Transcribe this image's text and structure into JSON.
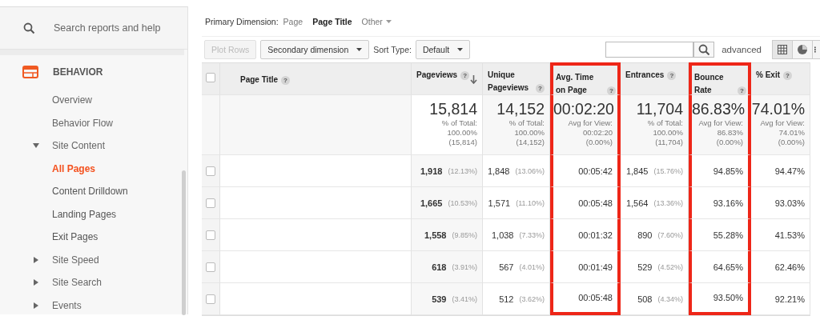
{
  "sidebar": {
    "search": {
      "placeholder": "Search reports and help"
    },
    "section": {
      "label": "BEHAVIOR",
      "children": [
        {
          "label": "Overview",
          "selected": false
        },
        {
          "label": "Behavior Flow",
          "selected": false
        },
        {
          "label": "Site Content",
          "selected": false,
          "expanded": true,
          "children": [
            {
              "label": "All Pages",
              "selected": true
            },
            {
              "label": "Content Drilldown",
              "selected": false
            },
            {
              "label": "Landing Pages",
              "selected": false
            },
            {
              "label": "Exit Pages",
              "selected": false
            }
          ]
        },
        {
          "label": "Site Speed",
          "selected": false,
          "expanded": false
        },
        {
          "label": "Site Search",
          "selected": false,
          "expanded": false
        },
        {
          "label": "Events",
          "selected": false,
          "expanded": false
        }
      ]
    }
  },
  "primary_dimension": {
    "label": "Primary Dimension:",
    "options": [
      {
        "label": "Page",
        "selected": false,
        "dropdown": false
      },
      {
        "label": "Page Title",
        "selected": true,
        "dropdown": false
      },
      {
        "label": "Other",
        "selected": false,
        "dropdown": true
      }
    ]
  },
  "toolbar": {
    "plot_rows": {
      "label": "Plot Rows",
      "disabled": true
    },
    "secondary_dimension": {
      "label": "Secondary dimension"
    },
    "sort_type_label": "Sort Type:",
    "sort_type": {
      "value": "Default"
    },
    "filter": {
      "focused": false
    },
    "advanced": "advanced",
    "views": [
      {
        "kind": "grid",
        "selected": true
      },
      {
        "kind": "pie",
        "selected": false
      },
      {
        "kind": "list",
        "selected": false
      }
    ]
  },
  "table": {
    "select_all": {
      "checked": false
    },
    "columns": [
      {
        "label": "Page Title",
        "help": "?",
        "sorted": false,
        "highlighted": false
      },
      {
        "label": "Pageviews",
        "help": "?",
        "sorted": true,
        "highlighted": false
      },
      {
        "label": "Unique Pageviews",
        "help": "?",
        "sorted": false,
        "highlighted": false
      },
      {
        "label": "Avg. Time on Page",
        "help": "?",
        "sorted": false,
        "highlighted": true
      },
      {
        "label": "Entrances",
        "help": "?",
        "sorted": false,
        "highlighted": false
      },
      {
        "label": "Bounce Rate",
        "help": "?",
        "sorted": false,
        "highlighted": true
      },
      {
        "label": "% Exit",
        "help": "?",
        "sorted": false,
        "highlighted": false
      }
    ],
    "totals": [
      {
        "value": "15,814",
        "lines": [
          "% of Total:",
          "100.00%",
          "(15,814)"
        ]
      },
      {
        "value": "14,152",
        "lines": [
          "% of Total:",
          "100.00%",
          "(14,152)"
        ]
      },
      {
        "value": "00:02:20",
        "lines": [
          "Avg for View:",
          "00:02:20",
          "(0.00%)"
        ]
      },
      {
        "value": "11,704",
        "lines": [
          "% of Total:",
          "100.00%",
          "(11,704)"
        ]
      },
      {
        "value": "86.83%",
        "lines": [
          "Avg for View:",
          "86.83%",
          "(0.00%)"
        ]
      },
      {
        "value": "74.01%",
        "lines": [
          "Avg for View:",
          "74.01%",
          "(0.00%)"
        ]
      }
    ],
    "rows": [
      {
        "checked": false,
        "cells": [
          {},
          {
            "value": "1,918",
            "share": "(12.13%)"
          },
          {
            "value": "1,848",
            "share": "(13.06%)"
          },
          {
            "value": "00:05:42"
          },
          {
            "value": "1,845",
            "share": "(15.76%)"
          },
          {
            "value": "94.85%"
          },
          {
            "value": "94.47%"
          }
        ]
      },
      {
        "checked": false,
        "cells": [
          {},
          {
            "value": "1,665",
            "share": "(10.53%)"
          },
          {
            "value": "1,571",
            "share": "(11.10%)"
          },
          {
            "value": "00:05:48"
          },
          {
            "value": "1,564",
            "share": "(13.36%)"
          },
          {
            "value": "93.16%"
          },
          {
            "value": "93.03%"
          }
        ]
      },
      {
        "checked": false,
        "cells": [
          {},
          {
            "value": "1,558",
            "share": "(9.85%)"
          },
          {
            "value": "1,038",
            "share": "(7.33%)"
          },
          {
            "value": "00:01:32"
          },
          {
            "value": "890",
            "share": "(7.60%)"
          },
          {
            "value": "55.28%"
          },
          {
            "value": "41.53%"
          }
        ]
      },
      {
        "checked": false,
        "cells": [
          {},
          {
            "value": "618",
            "share": "(3.91%)"
          },
          {
            "value": "567",
            "share": "(4.01%)"
          },
          {
            "value": "00:01:49"
          },
          {
            "value": "529",
            "share": "(4.52%)"
          },
          {
            "value": "64.65%"
          },
          {
            "value": "62.46%"
          }
        ]
      },
      {
        "checked": false,
        "cells": [
          {},
          {
            "value": "539",
            "share": "(3.41%)"
          },
          {
            "value": "512",
            "share": "(3.62%)"
          },
          {
            "value": "00:05:48"
          },
          {
            "value": "508",
            "share": "(4.34%)"
          },
          {
            "value": "93.50%"
          },
          {
            "value": "92.21%"
          }
        ]
      }
    ]
  }
}
